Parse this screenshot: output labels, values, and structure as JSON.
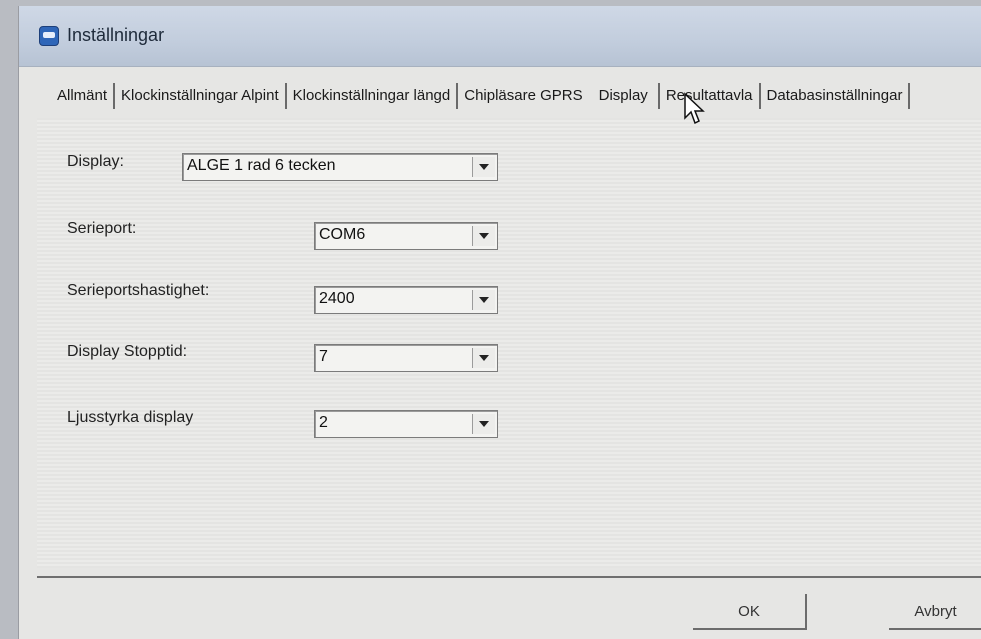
{
  "window": {
    "title": "Inställningar",
    "icon": "app-icon"
  },
  "tabs": [
    {
      "label": "Allmänt"
    },
    {
      "label": "Klockinställningar Alpint"
    },
    {
      "label": "Klockinställningar längd"
    },
    {
      "label": "Chipläsare GPRS"
    },
    {
      "label": "Display"
    },
    {
      "label": "Resultattavla"
    },
    {
      "label": "Databasinställningar"
    }
  ],
  "fields": {
    "display": {
      "label": "Display:",
      "value": "ALGE 1 rad 6 tecken"
    },
    "serieport": {
      "label": "Serieport:",
      "value": "COM6"
    },
    "serieportshastighet": {
      "label": "Serieportshastighet:",
      "value": "2400"
    },
    "display_stopptid": {
      "label": "Display Stopptid:",
      "value": "7"
    },
    "ljusstyrka": {
      "label": "Ljusstyrka display",
      "value": "2"
    }
  },
  "buttons": {
    "ok": "OK",
    "cancel": "Avbryt"
  }
}
